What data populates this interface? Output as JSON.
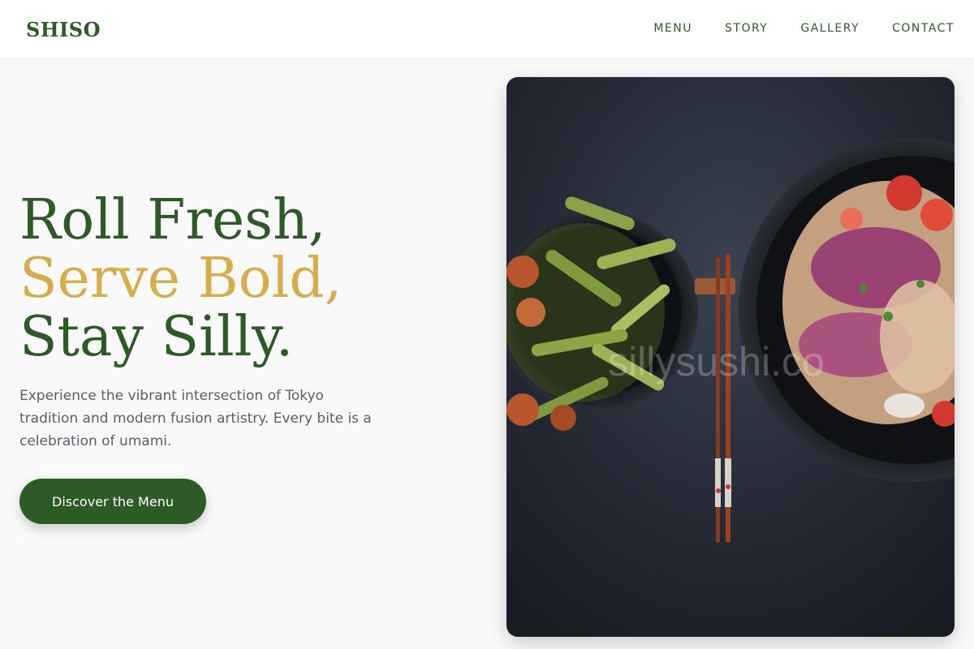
{
  "header": {
    "logo": "SHISO",
    "nav": [
      "MENU",
      "STORY",
      "GALLERY",
      "CONTACT"
    ]
  },
  "hero": {
    "headline_line1": "Roll Fresh,",
    "headline_line2": "Serve Bold,",
    "headline_line3": "Stay Silly.",
    "description": "Experience the vibrant intersection of Tokyo tradition and modern fusion artistry. Every bite is a celebration of umami.",
    "cta_label": "Discover the Menu"
  },
  "photo": {
    "watermark": "sillysushi.co",
    "alt": "Two bowls of Asian dishes with chopsticks on a dark surface"
  },
  "colors": {
    "brand_green": "#2e5a27",
    "accent_gold": "#d4ae4a",
    "text_gray": "#5a5f66",
    "background": "#f9f9f9"
  }
}
